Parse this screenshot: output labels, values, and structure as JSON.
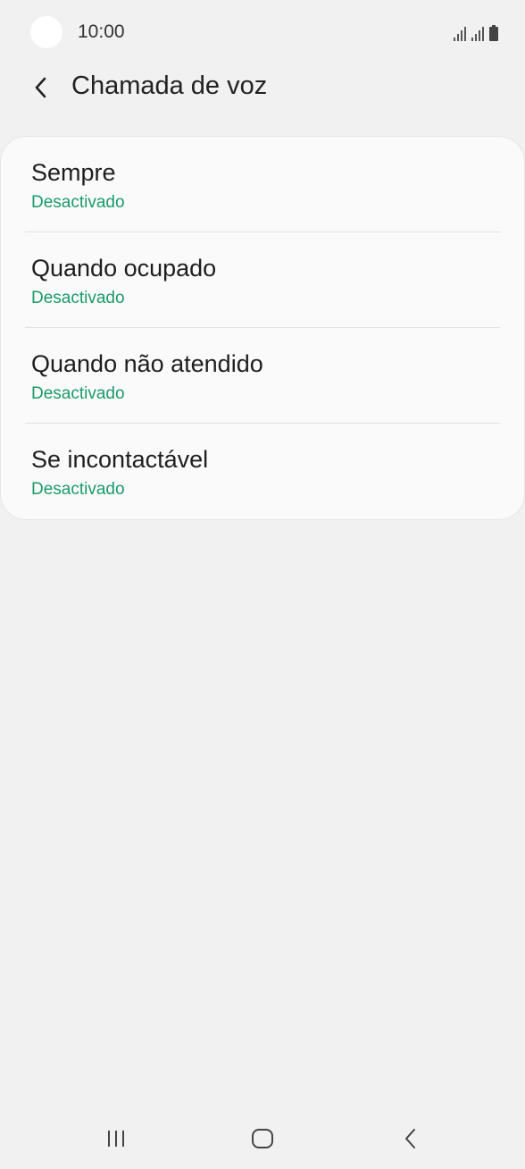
{
  "status_bar": {
    "time": "10:00"
  },
  "header": {
    "title": "Chamada de voz"
  },
  "list": {
    "items": [
      {
        "title": "Sempre",
        "status": "Desactivado"
      },
      {
        "title": "Quando ocupado",
        "status": "Desactivado"
      },
      {
        "title": "Quando não atendido",
        "status": "Desactivado"
      },
      {
        "title": "Se incontactável",
        "status": "Desactivado"
      }
    ]
  },
  "colors": {
    "background": "#f1f1f1",
    "card": "#fafafa",
    "status_green": "#1a9a6b",
    "title_text": "#222222"
  },
  "icons": {
    "back": "chevron-left-icon",
    "nav_recents": "recents-icon",
    "nav_home": "home-icon",
    "nav_back": "back-icon"
  }
}
